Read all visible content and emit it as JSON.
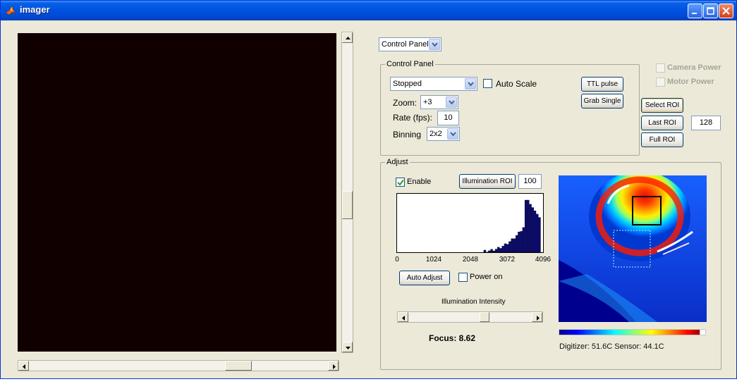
{
  "window": {
    "title": "imager"
  },
  "panel_selector": {
    "value": "Control Panel"
  },
  "control_panel": {
    "title": "Control Panel",
    "mode": "Stopped",
    "auto_scale_label": "Auto Scale",
    "auto_scale_checked": false,
    "ttl_pulse_label": "TTL pulse",
    "grab_single_label": "Grab Single",
    "zoom_label": "Zoom:",
    "zoom_value": "+3",
    "rate_label": "Rate (fps):",
    "rate_value": "10",
    "binning_label": "Binning",
    "binning_value": "2x2"
  },
  "power": {
    "camera_label": "Camera Power",
    "motor_label": "Motor Power",
    "camera_checked": false,
    "motor_checked": false
  },
  "roi": {
    "select_label": "Select ROI",
    "last_label": "Last ROI",
    "last_value": "128",
    "full_label": "Full ROI"
  },
  "adjust": {
    "title": "Adjust",
    "enable_label": "Enable",
    "enable_checked": true,
    "illumination_roi_label": "Illumination ROI",
    "illumination_roi_value": "100",
    "histogram_ticks": [
      "0",
      "1024",
      "2048",
      "3072",
      "4096"
    ],
    "auto_adjust_label": "Auto Adjust",
    "power_on_label": "Power on",
    "power_on_checked": false,
    "illumination_intensity_label": "Illumination Intensity",
    "illumination_intensity_level": 0.62,
    "focus_text": "Focus: 8.62"
  },
  "temperatures": {
    "text": "Digitizer: 51.6C  Sensor: 44.1C"
  },
  "colors": {
    "title_bar": "#0054e3",
    "image_background": "#110000",
    "face": "#ece9d8"
  }
}
